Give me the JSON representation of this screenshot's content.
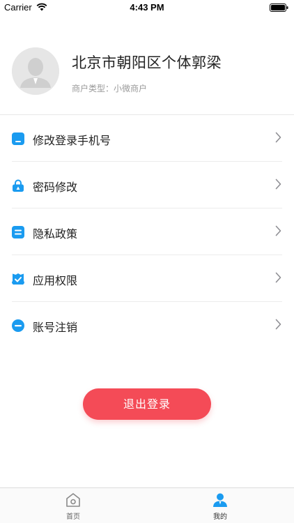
{
  "status_bar": {
    "carrier": "Carrier",
    "time": "4:43 PM"
  },
  "profile": {
    "name": "北京市朝阳区个体郭梁",
    "merchant_type": "商户类型：小微商户"
  },
  "menu": {
    "items": [
      {
        "label": "修改登录手机号",
        "icon": "phone-icon"
      },
      {
        "label": "密码修改",
        "icon": "lock-icon"
      },
      {
        "label": "隐私政策",
        "icon": "document-icon"
      },
      {
        "label": "应用权限",
        "icon": "shield-check-icon"
      },
      {
        "label": "账号注销",
        "icon": "minus-circle-icon"
      }
    ]
  },
  "logout": {
    "label": "退出登录"
  },
  "tab_bar": {
    "tabs": [
      {
        "label": "首页",
        "icon": "home-icon",
        "active": false
      },
      {
        "label": "我的",
        "icon": "user-icon",
        "active": true
      }
    ]
  },
  "colors": {
    "accent_blue": "#1a9bf0",
    "logout_red": "#f44b57",
    "text_primary": "#222222",
    "text_secondary": "#999999"
  }
}
